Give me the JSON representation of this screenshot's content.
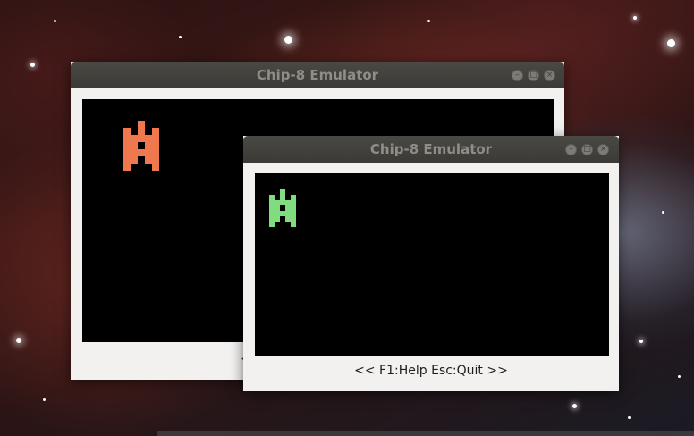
{
  "background": {
    "description_colors": {
      "nebula_red": "#3c1816",
      "nebula_blue": "#96aac8"
    }
  },
  "windows": [
    {
      "title": "Chip-8 Emulator",
      "status": "<< F1:Help Esc:Quit >>",
      "sprite_color": "#f0784e",
      "controls": {
        "minimize": "–",
        "maximize": "□",
        "close": "×"
      }
    },
    {
      "title": "Chip-8 Emulator",
      "status": "<< F1:Help Esc:Quit >>",
      "sprite_color": "#7fdc7f",
      "controls": {
        "minimize": "–",
        "maximize": "□",
        "close": "×"
      }
    }
  ],
  "colors": {
    "titlebar": "#3b3a36",
    "title_text": "#8e8d86",
    "window_body": "#f2f1f0",
    "screen": "#000000"
  }
}
